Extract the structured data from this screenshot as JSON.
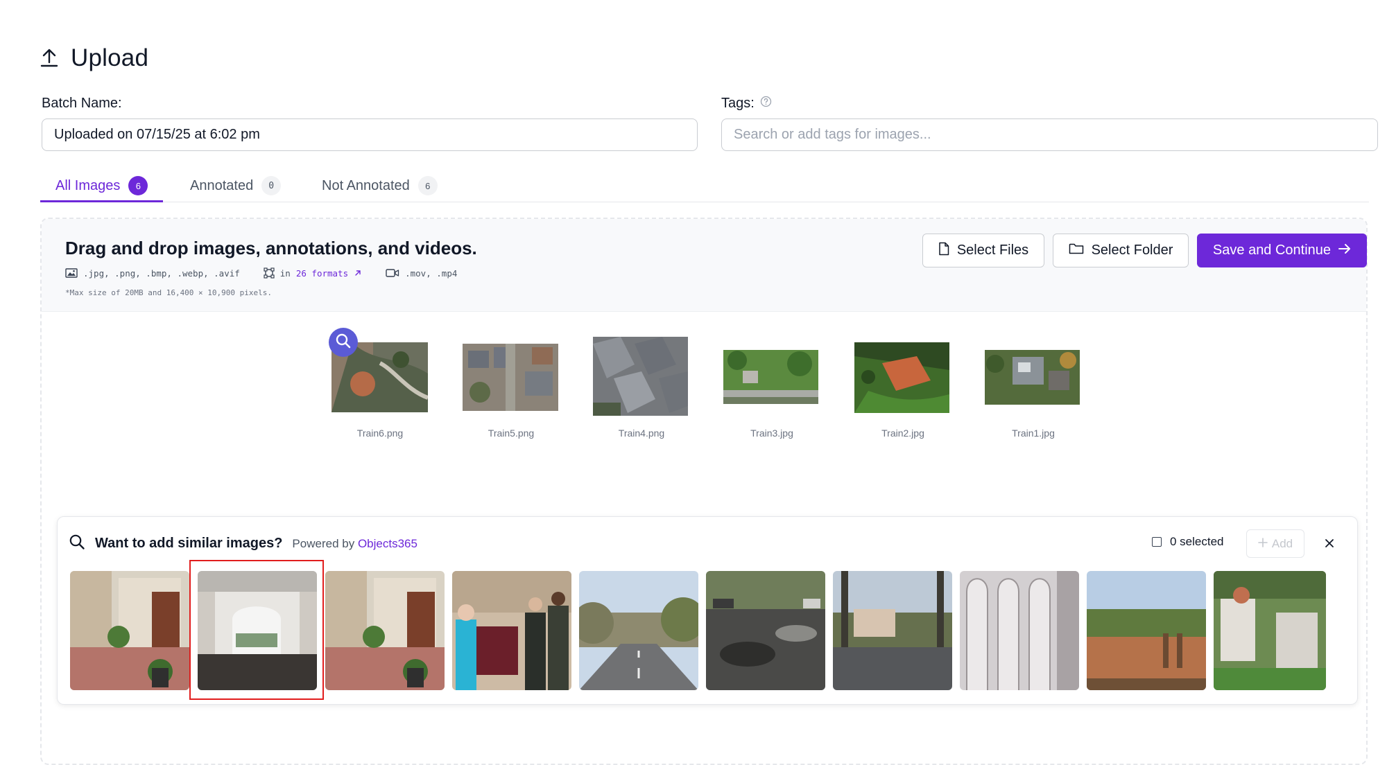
{
  "header": {
    "title": "Upload",
    "icon": "upload-icon"
  },
  "batch": {
    "label": "Batch Name:",
    "value": "Uploaded on 07/15/25 at 6:02 pm"
  },
  "tags": {
    "label": "Tags:",
    "placeholder": "Search or add tags for images..."
  },
  "tabs": [
    {
      "label": "All Images",
      "count": "6",
      "active": true
    },
    {
      "label": "Annotated",
      "count": "0",
      "active": false
    },
    {
      "label": "Not Annotated",
      "count": "6",
      "active": false
    }
  ],
  "dropzone": {
    "title": "Drag and drop images, annotations, and videos.",
    "image_formats": ".jpg, .png, .bmp, .webp, .avif",
    "annotation_prefix": "in",
    "annotation_formats": "26 formats",
    "video_formats": ".mov, .mp4",
    "max_note": "*Max size of 20MB and 16,400 × 10,900 pixels."
  },
  "buttons": {
    "select_files": "Select Files",
    "select_folder": "Select Folder",
    "save_continue": "Save and Continue"
  },
  "uploads": [
    {
      "name": "Train6.png"
    },
    {
      "name": "Train5.png"
    },
    {
      "name": "Train4.png"
    },
    {
      "name": "Train3.jpg"
    },
    {
      "name": "Train2.jpg"
    },
    {
      "name": "Train1.jpg"
    }
  ],
  "similar": {
    "question": "Want to add similar images?",
    "powered_prefix": "Powered by",
    "powered_name": "Objects365",
    "selected_text": "0 selected",
    "add_label": "Add",
    "images": [
      "courtyard-door",
      "covered-driveway",
      "courtyard-door",
      "ceremony-indoor",
      "tree-lined-road",
      "parking-lot",
      "street-trees",
      "arched-columns",
      "brick-plaza",
      "garden-stairs"
    ]
  },
  "colors": {
    "accent": "#6d28d9",
    "highlight": "#e11d1d",
    "zoom_badge": "#5b5bd6"
  }
}
